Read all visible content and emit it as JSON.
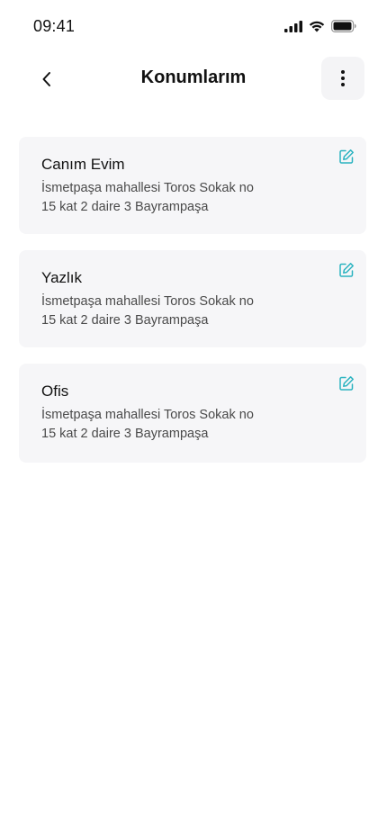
{
  "status": {
    "time": "09:41",
    "icons": [
      "cellular-signal-icon",
      "wifi-icon",
      "battery-icon"
    ]
  },
  "header": {
    "title": "Konumlarım",
    "back_icon": "chevron-left-icon",
    "more_icon": "vertical-dots-icon"
  },
  "colors": {
    "accent": "#2bb3c0",
    "card_bg": "#f6f6f8",
    "text_primary": "#111111",
    "text_secondary": "#4a4a4a"
  },
  "addresses": [
    {
      "name": "Canım Evim",
      "line1": "İsmetpaşa mahallesi Toros Sokak no",
      "line2": "15 kat 2 daire 3 Bayrampaşa"
    },
    {
      "name": "Yazlık",
      "line1": "İsmetpaşa mahallesi Toros Sokak no",
      "line2": "15 kat 2 daire 3 Bayrampaşa"
    },
    {
      "name": "Ofis",
      "line1": "İsmetpaşa mahallesi Toros Sokak no",
      "line2": "15 kat 2 daire 3 Bayrampaşa"
    }
  ]
}
